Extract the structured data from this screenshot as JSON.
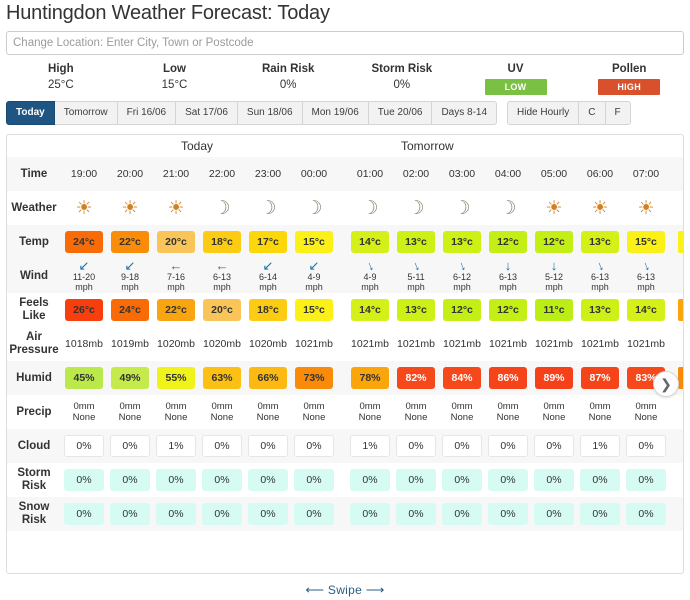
{
  "header": {
    "title": "Huntingdon Weather Forecast: Today",
    "location_input": {
      "value": "",
      "placeholder": "Change Location: Enter City, Town or Postcode"
    }
  },
  "summary": [
    {
      "label": "High",
      "value": "25°C",
      "type": "text"
    },
    {
      "label": "Low",
      "value": "15°C",
      "type": "text"
    },
    {
      "label": "Rain Risk",
      "value": "0%",
      "type": "text"
    },
    {
      "label": "Storm Risk",
      "value": "0%",
      "type": "text"
    },
    {
      "label": "UV",
      "value": "LOW",
      "type": "badge",
      "color": "#7ac143"
    },
    {
      "label": "Pollen",
      "value": "HIGH",
      "type": "badge",
      "color": "#d9512c"
    }
  ],
  "tabs": {
    "days": [
      {
        "label": "Today",
        "active": true
      },
      {
        "label": "Tomorrow",
        "active": false
      },
      {
        "label": "Fri 16/06",
        "active": false
      },
      {
        "label": "Sat 17/06",
        "active": false
      },
      {
        "label": "Sun 18/06",
        "active": false
      },
      {
        "label": "Mon 19/06",
        "active": false
      },
      {
        "label": "Tue 20/06",
        "active": false
      },
      {
        "label": "Days 8-14",
        "active": false
      }
    ],
    "controls": [
      {
        "label": "Hide Hourly"
      },
      {
        "label": "C"
      },
      {
        "label": "F"
      }
    ]
  },
  "forecast": {
    "day_headers": {
      "today": "Today",
      "tomorrow": "Tomorrow"
    },
    "row_labels": {
      "time": "Time",
      "weather": "Weather",
      "temp": "Temp",
      "wind": "Wind",
      "feels_like": "Feels Like",
      "air_pressure": "Air Pressure",
      "humid": "Humid",
      "precip": "Precip",
      "cloud": "Cloud",
      "storm_risk": "Storm Risk",
      "snow_risk": "Snow Risk"
    },
    "today": {
      "time": [
        "19:00",
        "20:00",
        "21:00",
        "22:00",
        "23:00",
        "00:00"
      ],
      "weather": [
        "sun-icon",
        "sun-icon",
        "sun-icon",
        "moon-icon",
        "moon-icon",
        "moon-icon"
      ],
      "temp": [
        {
          "value": "24°c",
          "color": "#f96b07"
        },
        {
          "value": "22°c",
          "color": "#f98d0a"
        },
        {
          "value": "20°c",
          "color": "#f9c558"
        },
        {
          "value": "18°c",
          "color": "#fccc14"
        },
        {
          "value": "17°c",
          "color": "#fcd70a"
        },
        {
          "value": "15°c",
          "color": "#fbf119"
        }
      ],
      "wind": [
        {
          "speed": "11-20",
          "unit": "mph",
          "dir": "sw"
        },
        {
          "speed": "9-18",
          "unit": "mph",
          "dir": "sw"
        },
        {
          "speed": "7-16",
          "unit": "mph",
          "dir": "w"
        },
        {
          "speed": "6-13",
          "unit": "mph",
          "dir": "w"
        },
        {
          "speed": "6-14",
          "unit": "mph",
          "dir": "sw"
        },
        {
          "speed": "4-9",
          "unit": "mph",
          "dir": "sw"
        }
      ],
      "feels_like": [
        {
          "value": "26°c",
          "color": "#f93e0e"
        },
        {
          "value": "24°c",
          "color": "#f96b07"
        },
        {
          "value": "22°c",
          "color": "#f9a411"
        },
        {
          "value": "20°c",
          "color": "#f9c558"
        },
        {
          "value": "18°c",
          "color": "#fccc14"
        },
        {
          "value": "15°c",
          "color": "#fbf119"
        }
      ],
      "air_pressure": [
        "1018mb",
        "1019mb",
        "1020mb",
        "1020mb",
        "1020mb",
        "1021mb"
      ],
      "humid": [
        {
          "value": "45%",
          "color": "#bbe84a",
          "light": false
        },
        {
          "value": "49%",
          "color": "#c5ea4b",
          "light": false
        },
        {
          "value": "55%",
          "color": "#f0f319",
          "light": false
        },
        {
          "value": "63%",
          "color": "#fcc015",
          "light": false
        },
        {
          "value": "66%",
          "color": "#fcb813",
          "light": false
        },
        {
          "value": "73%",
          "color": "#f98a0a",
          "light": false
        }
      ],
      "precip": [
        {
          "amount": "0mm",
          "type": "None"
        },
        {
          "amount": "0mm",
          "type": "None"
        },
        {
          "amount": "0mm",
          "type": "None"
        },
        {
          "amount": "0mm",
          "type": "None"
        },
        {
          "amount": "0mm",
          "type": "None"
        },
        {
          "amount": "0mm",
          "type": "None"
        }
      ],
      "cloud": [
        "0%",
        "0%",
        "1%",
        "0%",
        "0%",
        "0%"
      ],
      "storm_risk": [
        "0%",
        "0%",
        "0%",
        "0%",
        "0%",
        "0%"
      ],
      "snow_risk": [
        "0%",
        "0%",
        "0%",
        "0%",
        "0%",
        "0%"
      ]
    },
    "tomorrow": {
      "time": [
        "01:00",
        "02:00",
        "03:00",
        "04:00",
        "05:00",
        "06:00",
        "07:00"
      ],
      "weather": [
        "moon-icon",
        "moon-icon",
        "moon-icon",
        "moon-icon",
        "sun-icon",
        "sun-icon",
        "sun-icon"
      ],
      "temp": [
        {
          "value": "14°c",
          "color": "#d5f018"
        },
        {
          "value": "13°c",
          "color": "#cdf017"
        },
        {
          "value": "13°c",
          "color": "#cdf017"
        },
        {
          "value": "12°c",
          "color": "#c3ef16"
        },
        {
          "value": "12°c",
          "color": "#c3ef16"
        },
        {
          "value": "13°c",
          "color": "#d5f018"
        },
        {
          "value": "15°c",
          "color": "#fbf119"
        }
      ],
      "wind": [
        {
          "speed": "4-9",
          "unit": "mph",
          "dir": "s-sw"
        },
        {
          "speed": "5-11",
          "unit": "mph",
          "dir": "s-sw"
        },
        {
          "speed": "6-12",
          "unit": "mph",
          "dir": "s-sw"
        },
        {
          "speed": "6-13",
          "unit": "mph",
          "dir": "s"
        },
        {
          "speed": "5-12",
          "unit": "mph",
          "dir": "s"
        },
        {
          "speed": "6-13",
          "unit": "mph",
          "dir": "s-sw"
        },
        {
          "speed": "6-13",
          "unit": "mph",
          "dir": "s-sw"
        }
      ],
      "feels_like": [
        {
          "value": "14°c",
          "color": "#d5f018"
        },
        {
          "value": "13°c",
          "color": "#cdf017"
        },
        {
          "value": "12°c",
          "color": "#c3ef16"
        },
        {
          "value": "12°c",
          "color": "#c3ef16"
        },
        {
          "value": "11°c",
          "color": "#bbee15"
        },
        {
          "value": "13°c",
          "color": "#cdf017"
        },
        {
          "value": "14°c",
          "color": "#d5f018"
        }
      ],
      "air_pressure": [
        "1021mb",
        "1021mb",
        "1021mb",
        "1021mb",
        "1021mb",
        "1021mb",
        "1021mb"
      ],
      "humid": [
        {
          "value": "78%",
          "color": "#fba50d",
          "light": false
        },
        {
          "value": "82%",
          "color": "#f5481b",
          "light": true
        },
        {
          "value": "84%",
          "color": "#f5481b",
          "light": true
        },
        {
          "value": "86%",
          "color": "#f5431a",
          "light": true
        },
        {
          "value": "89%",
          "color": "#f5401a",
          "light": true
        },
        {
          "value": "87%",
          "color": "#f5431a",
          "light": true
        },
        {
          "value": "83%",
          "color": "#f5481b",
          "light": true
        }
      ],
      "precip": [
        {
          "amount": "0mm",
          "type": "None"
        },
        {
          "amount": "0mm",
          "type": "None"
        },
        {
          "amount": "0mm",
          "type": "None"
        },
        {
          "amount": "0mm",
          "type": "None"
        },
        {
          "amount": "0mm",
          "type": "None"
        },
        {
          "amount": "0mm",
          "type": "None"
        },
        {
          "amount": "0mm",
          "type": "None"
        }
      ],
      "cloud": [
        "1%",
        "0%",
        "0%",
        "0%",
        "0%",
        "1%",
        "0%"
      ],
      "storm_risk": [
        "0%",
        "0%",
        "0%",
        "0%",
        "0%",
        "0%",
        "0%"
      ],
      "snow_risk": [
        "0%",
        "0%",
        "0%",
        "0%",
        "0%",
        "0%",
        "0%"
      ]
    }
  },
  "next_arrow": "❯",
  "footer": {
    "swipe_label": "Swipe",
    "left_arrow": "⟵",
    "right_arrow": "⟶"
  }
}
